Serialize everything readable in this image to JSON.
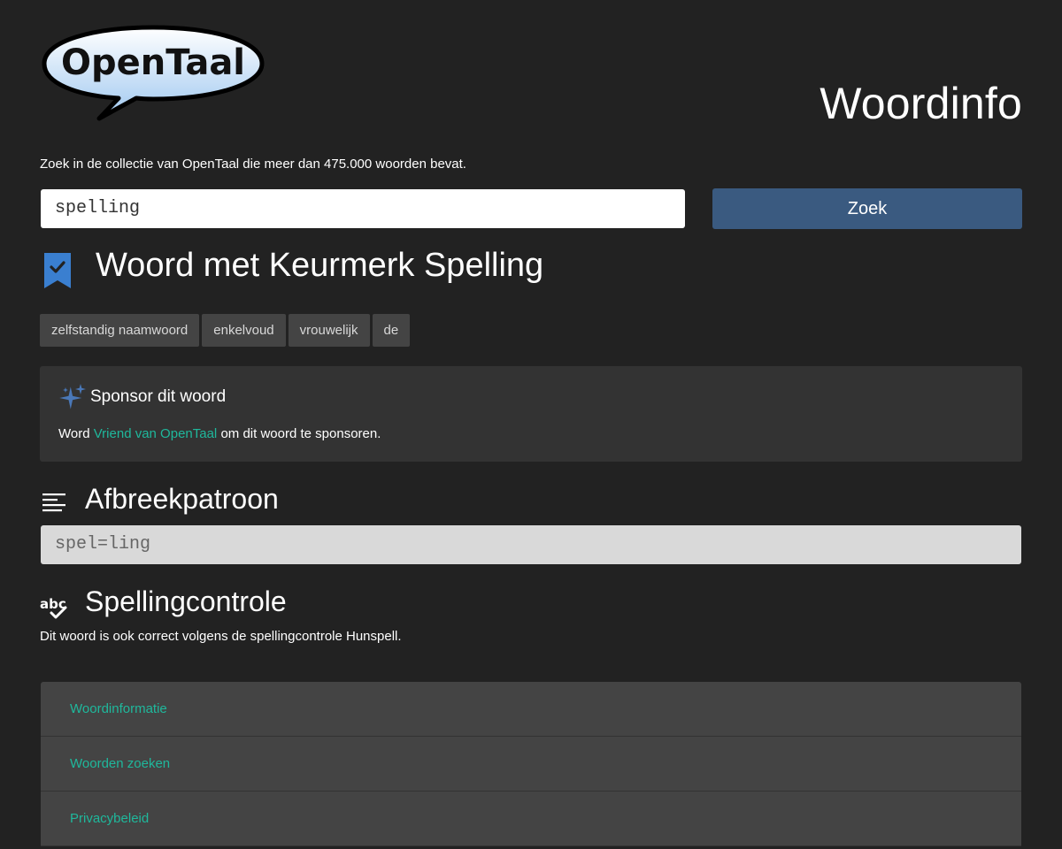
{
  "header": {
    "logo_text": "OpenTaal",
    "title": "Woordinfo"
  },
  "intro": "Zoek in de collectie van OpenTaal die meer dan 475.000 woorden bevat.",
  "search": {
    "value": "spelling",
    "button_label": "Zoek"
  },
  "keurmerk": {
    "title": "Woord met Keurmerk Spelling",
    "icon": "bookmark-check-icon",
    "icon_color": "#3a7fd0"
  },
  "tags": [
    "zelfstandig naamwoord",
    "enkelvoud",
    "vrouwelijk",
    "de"
  ],
  "sponsor": {
    "title": "Sponsor dit woord",
    "text_before": "Word ",
    "link": "Vriend van OpenTaal",
    "text_after": " om dit woord te sponsoren.",
    "icon": "sparkle-icon",
    "link_color": "#1fb89c"
  },
  "hyphenation": {
    "title": "Afbreekpatroon",
    "pattern": "spel=ling",
    "icon": "text-lines-icon"
  },
  "spellcheck": {
    "title": "Spellingcontrole",
    "text": "Dit woord is ook correct volgens de spellingcontrole Hunspell.",
    "icon": "abc-check-icon"
  },
  "footer": {
    "links": [
      "Woordinformatie",
      "Woorden zoeken",
      "Privacybeleid"
    ]
  },
  "colors": {
    "background": "#222222",
    "button": "#3a5a80",
    "accent": "#1fb89c"
  }
}
